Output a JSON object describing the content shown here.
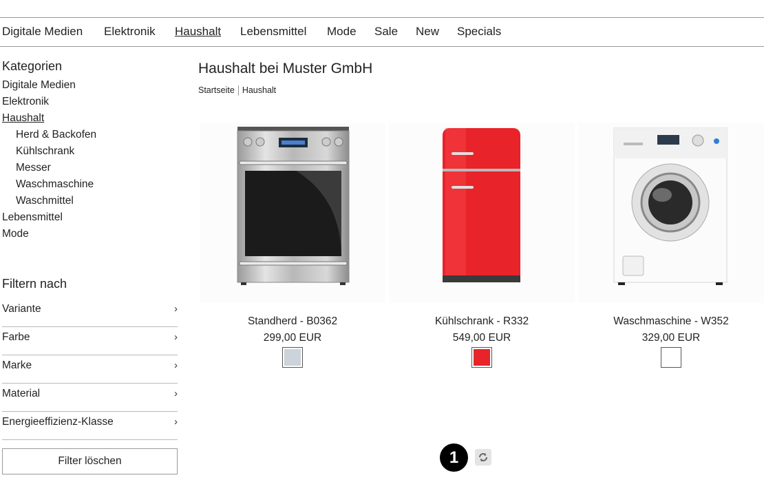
{
  "nav": {
    "items": [
      {
        "label": "Digitale Medien"
      },
      {
        "label": "Elektronik"
      },
      {
        "label": "Haushalt",
        "active": true
      },
      {
        "label": "Lebensmittel"
      },
      {
        "label": "Mode"
      },
      {
        "label": "Sale"
      },
      {
        "label": "New"
      },
      {
        "label": "Specials"
      }
    ]
  },
  "sidebar": {
    "categories_heading": "Kategorien",
    "categories": [
      {
        "label": "Digitale Medien"
      },
      {
        "label": "Elektronik"
      },
      {
        "label": "Haushalt",
        "active": true
      },
      {
        "label": "Herd & Backofen",
        "sub": true
      },
      {
        "label": "Kühlschrank",
        "sub": true
      },
      {
        "label": "Messer",
        "sub": true
      },
      {
        "label": "Waschmaschine",
        "sub": true
      },
      {
        "label": "Waschmittel",
        "sub": true
      },
      {
        "label": "Lebensmittel"
      },
      {
        "label": "Mode"
      }
    ],
    "filter_heading": "Filtern nach",
    "filters": [
      {
        "label": "Variante"
      },
      {
        "label": "Farbe"
      },
      {
        "label": "Marke"
      },
      {
        "label": "Material"
      },
      {
        "label": "Energieeffizienz-Klasse"
      }
    ],
    "filter_chevron": "›",
    "clear_label": "Filter löschen"
  },
  "main": {
    "title": "Haushalt bei Muster GmbH",
    "breadcrumb": [
      "Startseite",
      "Haushalt"
    ],
    "products": [
      {
        "name": "Standherd - B0362",
        "price": "299,00 EUR",
        "swatch_color": "#cdd3da",
        "image": "oven-image"
      },
      {
        "name": "Kühlschrank - R332",
        "price": "549,00 EUR",
        "swatch_color": "#e8232a",
        "image": "fridge-image"
      },
      {
        "name": "Waschmaschine - W352",
        "price": "329,00 EUR",
        "swatch_color": "#ffffff",
        "image": "washing-machine-image"
      }
    ]
  },
  "pagination": {
    "current_page": "1",
    "reload_icon": "reload-icon"
  }
}
